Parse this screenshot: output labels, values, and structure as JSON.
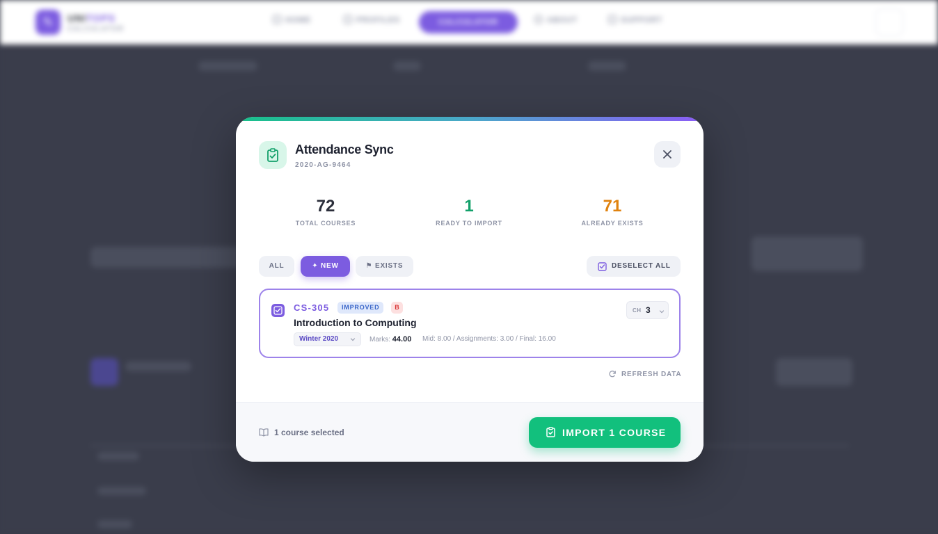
{
  "app": {
    "logo_line1_a": "UNI",
    "logo_line1_b": "TOPS",
    "logo_line2": "CALCULATOR",
    "nav": {
      "home": "HOME",
      "profiles": "PROFILES",
      "calculator": "CALCULATOR",
      "about": "ABOUT",
      "support": "SUPPORT"
    }
  },
  "modal": {
    "title": "Attendance Sync",
    "subtitle": "2020-AG-9464",
    "header_icon": "clipboard-check-icon",
    "stats": [
      {
        "value": "72",
        "label": "TOTAL COURSES",
        "color": "#2b2e3a"
      },
      {
        "value": "1",
        "label": "READY TO IMPORT",
        "color": "#12a06a"
      },
      {
        "value": "71",
        "label": "ALREADY EXISTS",
        "color": "#e0820e"
      }
    ],
    "filters": {
      "all": "ALL",
      "new": "✦ NEW",
      "exists": "⚑ EXISTS",
      "active": "new"
    },
    "deselect_label": "DESELECT ALL",
    "courses": [
      {
        "code": "CS-305",
        "status_badge": "IMPROVED",
        "grade": "B",
        "name": "Introduction to Computing",
        "semester": "Winter 2020",
        "marks_label": "Marks:",
        "marks_value": "44.00",
        "breakdown": "Mid: 8.00 / Assignments: 3.00 / Final: 16.00",
        "ch_label": "CH",
        "ch_value": "3",
        "selected": true
      }
    ],
    "refresh_label": "REFRESH DATA",
    "footer": {
      "selected_text": "1 course selected",
      "import_label": "IMPORT 1 COURSE"
    }
  },
  "colors": {
    "accent": "#7c5ce0",
    "success": "#12c07d",
    "warning": "#e0820e"
  }
}
